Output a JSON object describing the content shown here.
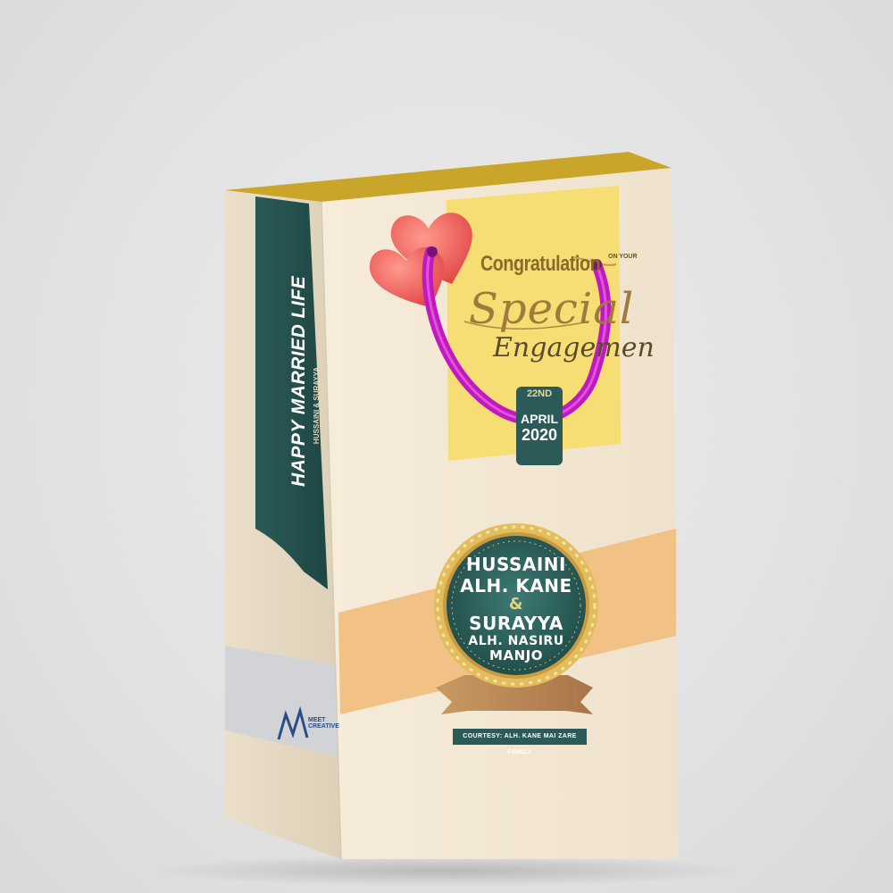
{
  "front": {
    "congrats": "Congratulation",
    "on_your": "ON YOUR",
    "special": "Special",
    "engagement": "Engagemen",
    "date_day": "22ND",
    "date_month": "APRIL",
    "date_year": "2020"
  },
  "seal": {
    "line1": "HUSSAINI",
    "line2": "ALH. KANE",
    "amp": "&",
    "line3": "SURAYYA",
    "line4": "ALH. NASIRU",
    "line5": "MANJO"
  },
  "courtesy": "COURTESY: ALH. KANE MAI ZARE FAMILY",
  "side": {
    "title": "HAPPY MARRIED LIFE",
    "subtitle": "HUSSAINI & SURAYYA"
  },
  "logo": {
    "line1": "MEET",
    "line2": "CREATIVE"
  },
  "colors": {
    "bag_front": "#f3e8d6",
    "bag_side": "#e9dcc6",
    "inner": "#d6b52a",
    "teal": "#2c5a58",
    "stripe": "#f3bf80",
    "yellow_card": "#f6df75",
    "handle": "#cc18c8",
    "gold": "#c9a24a"
  }
}
